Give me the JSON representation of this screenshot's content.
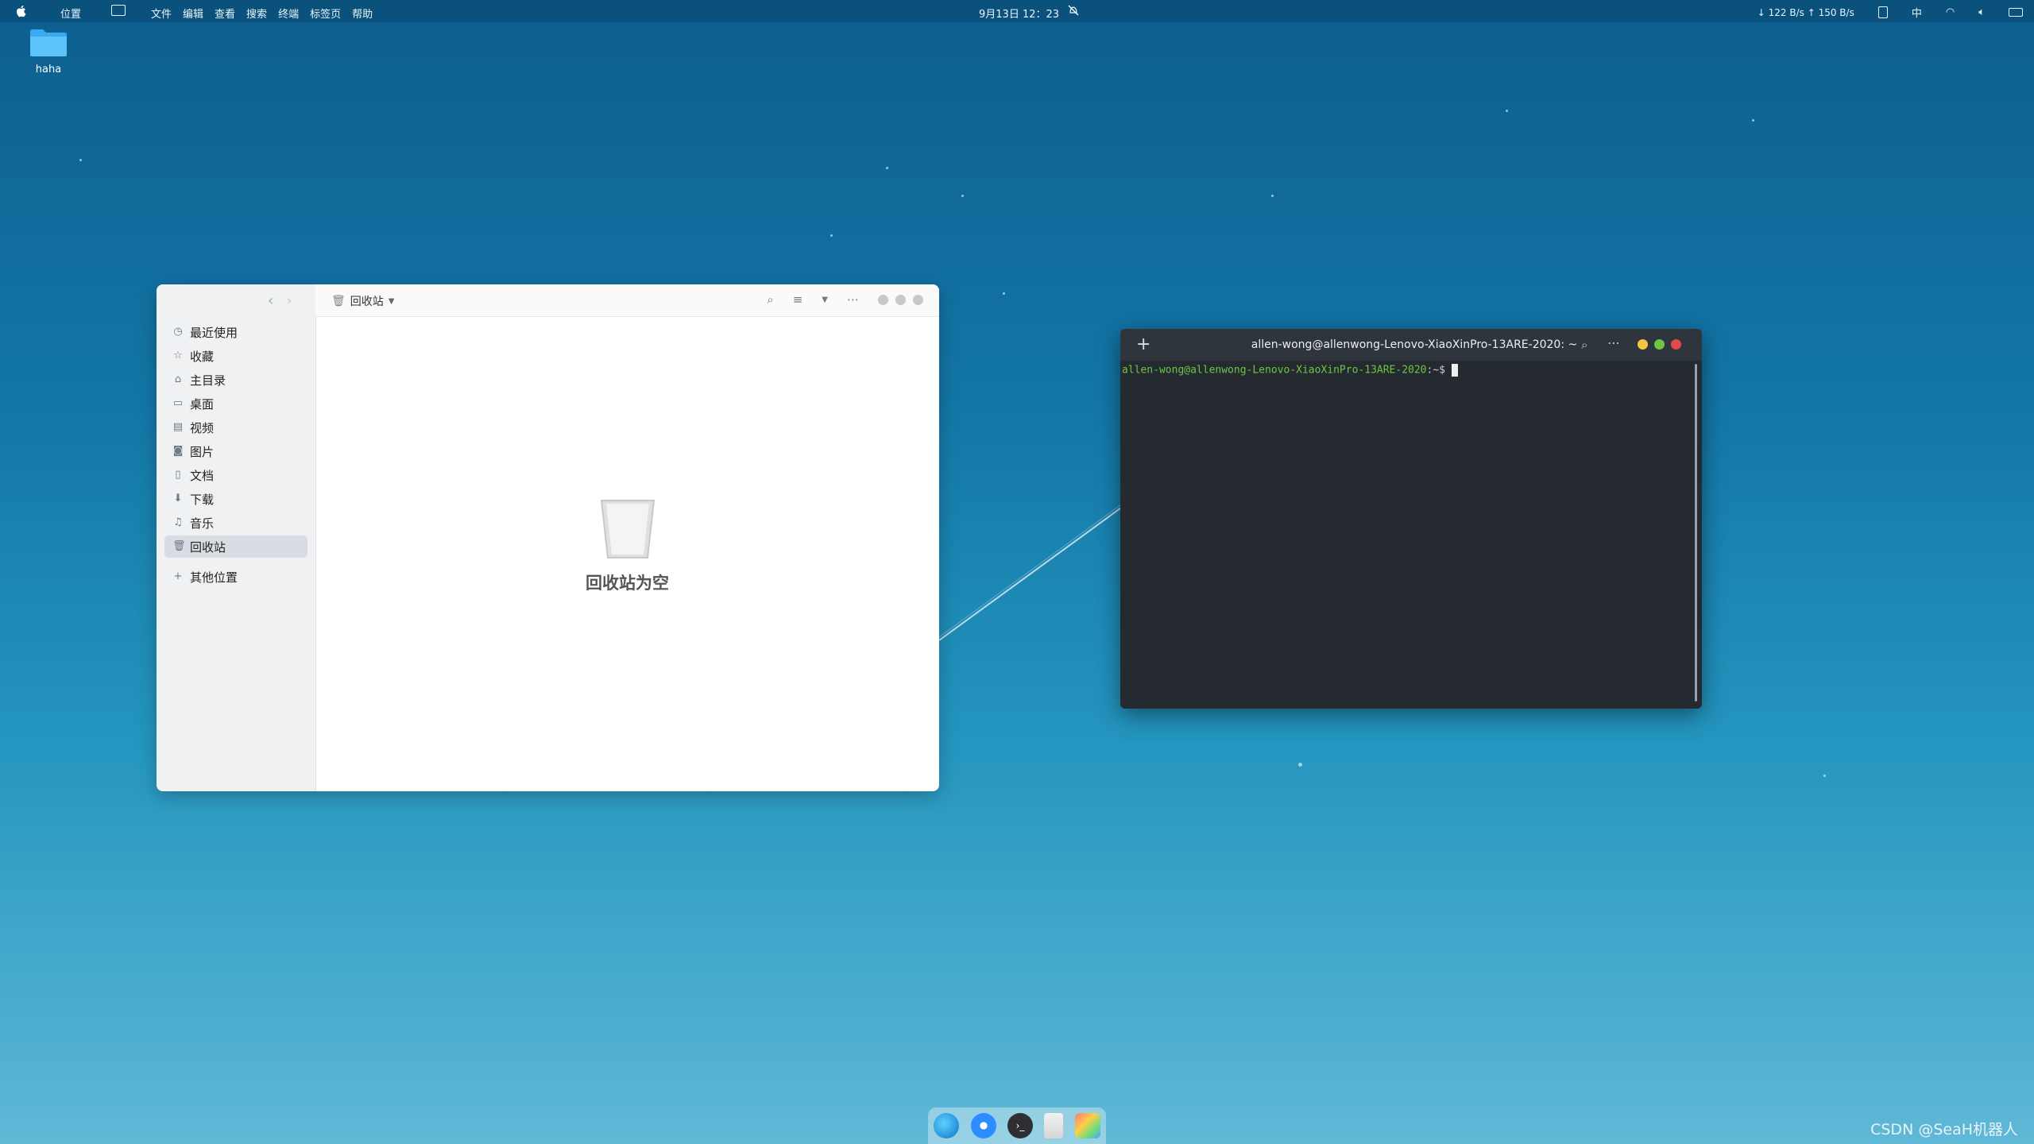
{
  "topbar": {
    "places": "位置",
    "menus": [
      "文件",
      "编辑",
      "查看",
      "搜索",
      "终端",
      "标签页",
      "帮助"
    ],
    "clock": "9月13日 12：23",
    "net": "↓ 122 B/s ↑ 150 B/s",
    "ime": "中"
  },
  "desktop": {
    "folder_label": "haha"
  },
  "file_manager": {
    "breadcrumb": "回收站",
    "sidebar": [
      {
        "label": "最近使用",
        "icon": "clock-icon"
      },
      {
        "label": "收藏",
        "icon": "star-icon"
      },
      {
        "label": "主目录",
        "icon": "home-icon"
      },
      {
        "label": "桌面",
        "icon": "desktop-icon"
      },
      {
        "label": "视频",
        "icon": "video-icon"
      },
      {
        "label": "图片",
        "icon": "camera-icon"
      },
      {
        "label": "文档",
        "icon": "document-icon"
      },
      {
        "label": "下载",
        "icon": "download-icon"
      },
      {
        "label": "音乐",
        "icon": "music-icon"
      },
      {
        "label": "回收站",
        "icon": "trash-icon"
      }
    ],
    "other_places": "其他位置",
    "empty_message": "回收站为空"
  },
  "terminal": {
    "title": "allen-wong@allenwong-Lenovo-XiaoXinPro-13ARE-2020: ~",
    "prompt_user": "allen-wong@allenwong-Lenovo-XiaoXinPro-13ARE-2020",
    "prompt_suffix": ":~$",
    "colors": {
      "prompt": "#6cc644",
      "close": "#e5484d",
      "min": "#f5c542",
      "max": "#6cc644"
    }
  },
  "watermark": "CSDN @SeaH机器人"
}
